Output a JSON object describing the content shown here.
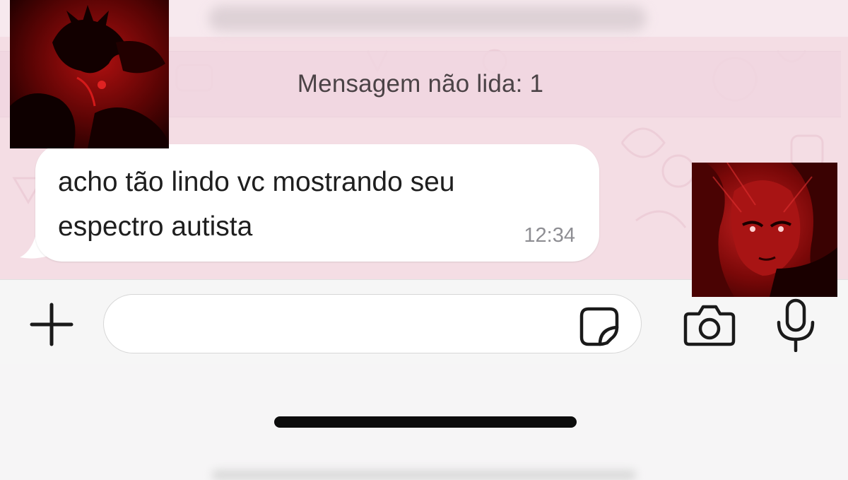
{
  "chat": {
    "unread_banner": "Mensagem não lida: 1",
    "message": {
      "line1": "acho tão lindo vc mostrando seu",
      "line2": "espectro autista",
      "time": "12:34"
    }
  },
  "input_bar": {
    "text_value": "",
    "icons": [
      "plus-icon",
      "sticker-icon",
      "camera-icon",
      "microphone-icon"
    ]
  },
  "colors": {
    "chat_background": "#f4dde4",
    "bubble": "#ffffff",
    "time_text": "#8e8e93",
    "art_red": "#8b0a0a"
  }
}
